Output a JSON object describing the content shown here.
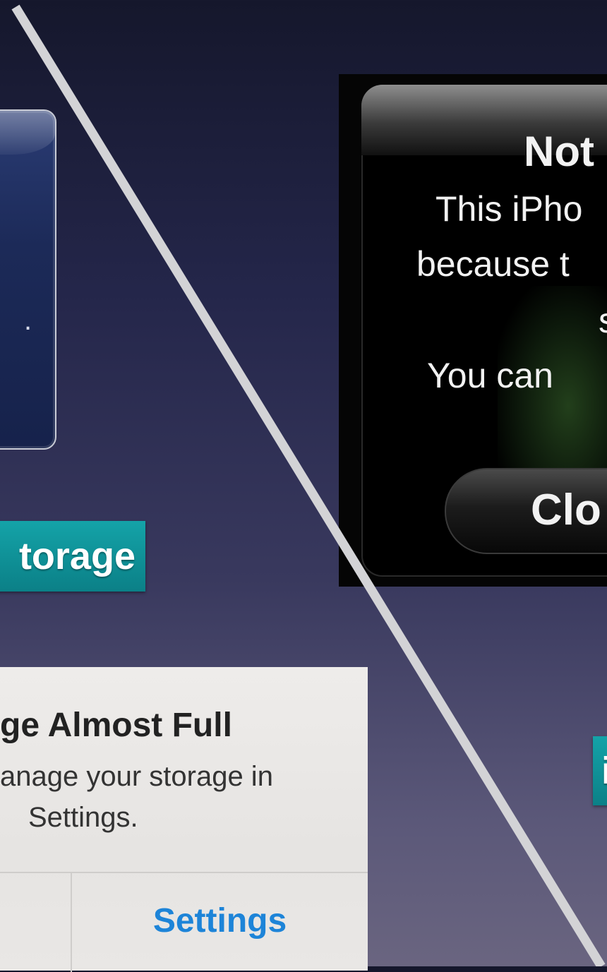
{
  "left_alert": {
    "fragment": "."
  },
  "labels": {
    "left": "torage",
    "right": "i"
  },
  "black_alert": {
    "title": "Not",
    "line1": "This iPho",
    "line2": "because t",
    "line3": "s",
    "line4": "You can",
    "button": "Clo"
  },
  "ios_alert": {
    "title": "ge Almost Full",
    "message_line1": "anage your storage in",
    "message_line2": "Settings.",
    "button": "Settings"
  },
  "colors": {
    "teal": "#0b8087",
    "ios_link": "#1d84d8",
    "divider_line": "#d3d3d6"
  }
}
